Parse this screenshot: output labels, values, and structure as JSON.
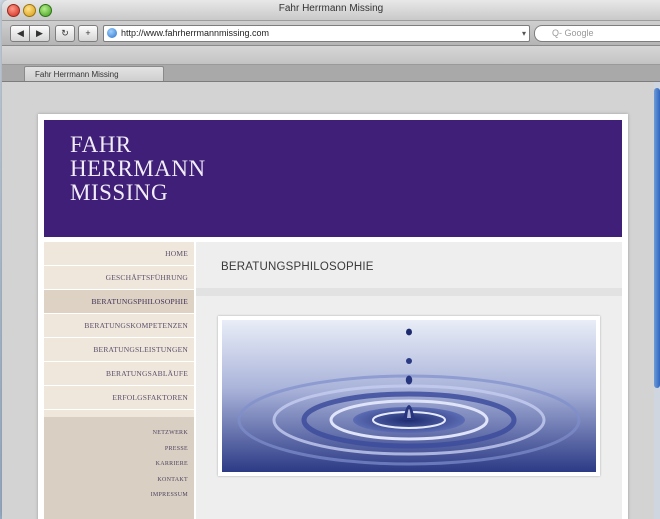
{
  "browser": {
    "window_title": "Fahr Herrmann Missing",
    "url": "http://www.fahrherrmannmissing.com",
    "search_placeholder": "Q- Google",
    "tab_title": "Fahr Herrmann Missing",
    "buttons": {
      "back": "◀",
      "forward": "▶",
      "reload": "↻",
      "add": "+"
    }
  },
  "site": {
    "logo_lines": [
      "FAHR",
      "HERRMANN",
      "MISSING"
    ],
    "nav_main": [
      "HOME",
      "GESCHÄFTSFÜHRUNG",
      "BERATUNGSPHILOSOPHIE",
      "BERATUNGSKOMPETENZEN",
      "BERATUNGSLEISTUNGEN",
      "BERATUNGSABLÄUFE",
      "ERFOLGSFAKTOREN"
    ],
    "nav_active_index": 2,
    "nav_secondary": [
      "NETZWERK",
      "PRESSE",
      "KARRIERE",
      "KONTAKT",
      "IMPRESSUM"
    ],
    "page_heading": "BERATUNGSPHILOSOPHIE",
    "hero_icon": "water-drop-ripple-image"
  },
  "colors": {
    "header_purple": "#3f1f77",
    "sidebar_beige": "#efe7dc",
    "nav_active": "#ddd2c4",
    "secondary_nav": "#d9cfc3",
    "water_blue": "#3a4a9a"
  }
}
